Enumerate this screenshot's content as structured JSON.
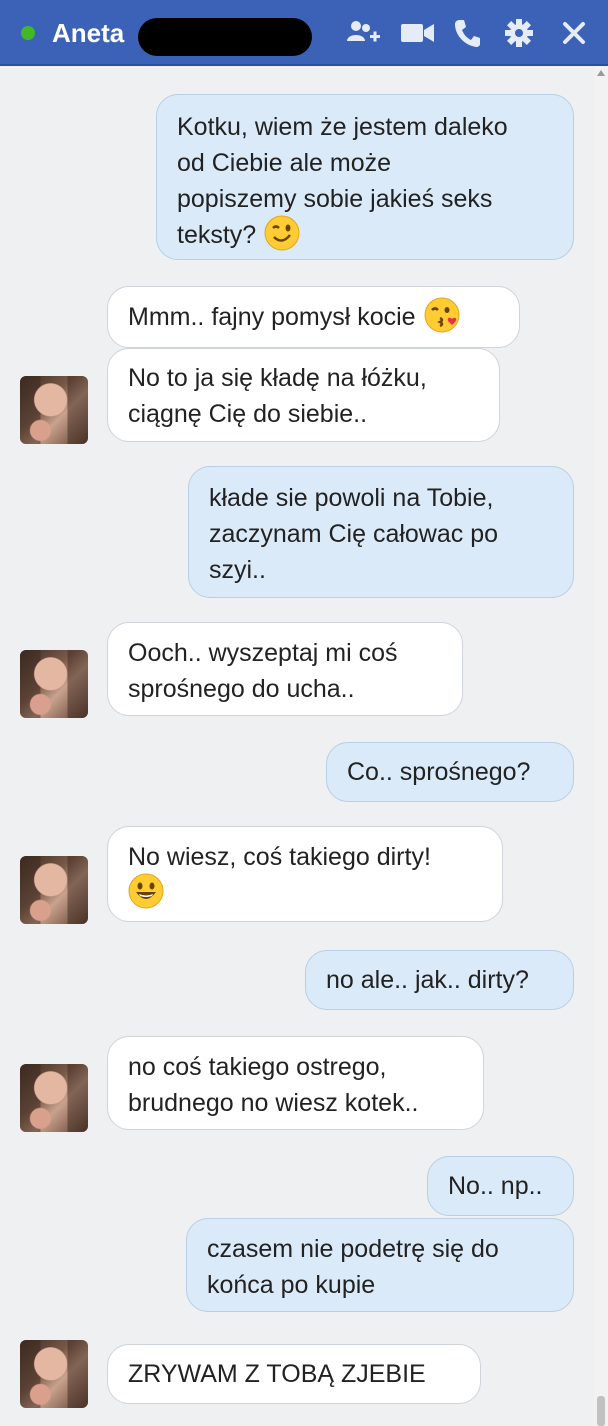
{
  "header": {
    "contact_name": "Aneta",
    "status": "online",
    "colors": {
      "bar": "#3b62b7",
      "online": "#42b72a"
    },
    "icons": [
      "add-friend-icon",
      "video-call-icon",
      "phone-call-icon",
      "settings-gear-icon",
      "close-icon"
    ]
  },
  "messages": [
    {
      "from": "me",
      "lines": [
        "Kotku, wiem że jestem daleko",
        "od Ciebie ale może",
        "popiszemy sobie jakieś seks",
        "teksty?"
      ],
      "emoji": "wink"
    },
    {
      "from": "contact",
      "lines": [
        "Mmm.. fajny pomysł kocie"
      ],
      "emoji": "kiss"
    },
    {
      "from": "contact",
      "lines": [
        "No to ja się kładę na łóżku,",
        "ciągnę Cię do siebie.."
      ]
    },
    {
      "from": "me",
      "lines": [
        "kłade sie powoli na Tobie,",
        "zaczynam Cię całowac po",
        "szyi.."
      ]
    },
    {
      "from": "contact",
      "lines": [
        "Ooch.. wyszeptaj mi coś",
        "sprośnego do ucha.."
      ]
    },
    {
      "from": "me",
      "lines": [
        "Co.. sprośnego?"
      ]
    },
    {
      "from": "contact",
      "lines": [
        "No wiesz, coś takiego dirty!"
      ],
      "emoji_line": "grin"
    },
    {
      "from": "me",
      "lines": [
        "no ale.. jak.. dirty?"
      ]
    },
    {
      "from": "contact",
      "lines": [
        "no coś takiego ostrego,",
        "brudnego no wiesz kotek.."
      ]
    },
    {
      "from": "me",
      "lines": [
        "No.. np.."
      ]
    },
    {
      "from": "me",
      "lines": [
        "czasem nie podetrę się do",
        "końca po kupie"
      ]
    },
    {
      "from": "contact",
      "lines": [
        "ZRYWAM Z TOBĄ ZJEBIE"
      ]
    }
  ]
}
